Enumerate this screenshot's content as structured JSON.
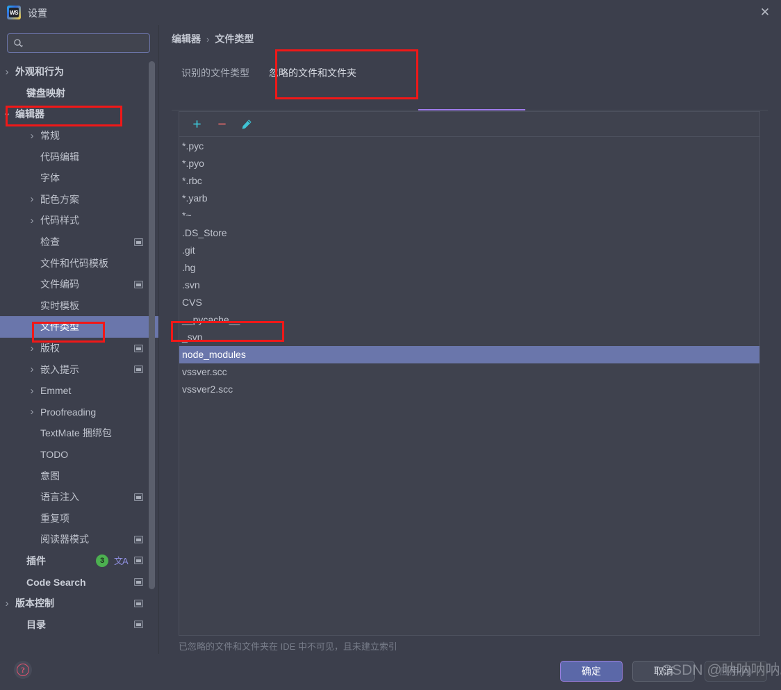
{
  "window": {
    "title": "设置",
    "app_icon": "webstorm-icon",
    "close_label": "✕"
  },
  "search": {
    "value": "",
    "placeholder": "",
    "icon": "search-icon"
  },
  "sidebar": {
    "items": [
      {
        "label": "外观和行为",
        "indent": 22,
        "chevron": "right",
        "bold": true,
        "sync": false,
        "selected": false
      },
      {
        "label": "键盘映射",
        "indent": 38,
        "chevron": "",
        "bold": true,
        "sync": false,
        "selected": false
      },
      {
        "label": "编辑器",
        "indent": 22,
        "chevron": "down",
        "bold": true,
        "sync": false,
        "selected": false
      },
      {
        "label": "常规",
        "indent": 58,
        "chevron": "right",
        "bold": false,
        "sync": false,
        "selected": false
      },
      {
        "label": "代码编辑",
        "indent": 58,
        "chevron": "",
        "bold": false,
        "sync": false,
        "selected": false
      },
      {
        "label": "字体",
        "indent": 58,
        "chevron": "",
        "bold": false,
        "sync": false,
        "selected": false
      },
      {
        "label": "配色方案",
        "indent": 58,
        "chevron": "right",
        "bold": false,
        "sync": false,
        "selected": false
      },
      {
        "label": "代码样式",
        "indent": 58,
        "chevron": "right",
        "bold": false,
        "sync": false,
        "selected": false
      },
      {
        "label": "检查",
        "indent": 58,
        "chevron": "",
        "bold": false,
        "sync": true,
        "selected": false
      },
      {
        "label": "文件和代码模板",
        "indent": 58,
        "chevron": "",
        "bold": false,
        "sync": false,
        "selected": false
      },
      {
        "label": "文件编码",
        "indent": 58,
        "chevron": "",
        "bold": false,
        "sync": true,
        "selected": false
      },
      {
        "label": "实时模板",
        "indent": 58,
        "chevron": "",
        "bold": false,
        "sync": false,
        "selected": false
      },
      {
        "label": "文件类型",
        "indent": 58,
        "chevron": "",
        "bold": false,
        "sync": false,
        "selected": true
      },
      {
        "label": "版权",
        "indent": 58,
        "chevron": "right",
        "bold": false,
        "sync": true,
        "selected": false
      },
      {
        "label": "嵌入提示",
        "indent": 58,
        "chevron": "right",
        "bold": false,
        "sync": true,
        "selected": false
      },
      {
        "label": "Emmet",
        "indent": 58,
        "chevron": "right",
        "bold": false,
        "sync": false,
        "selected": false
      },
      {
        "label": "Proofreading",
        "indent": 58,
        "chevron": "right",
        "bold": false,
        "sync": false,
        "selected": false
      },
      {
        "label": "TextMate 捆绑包",
        "indent": 58,
        "chevron": "",
        "bold": false,
        "sync": false,
        "selected": false
      },
      {
        "label": "TODO",
        "indent": 58,
        "chevron": "",
        "bold": false,
        "sync": false,
        "selected": false
      },
      {
        "label": "意图",
        "indent": 58,
        "chevron": "",
        "bold": false,
        "sync": false,
        "selected": false
      },
      {
        "label": "语言注入",
        "indent": 58,
        "chevron": "",
        "bold": false,
        "sync": true,
        "selected": false
      },
      {
        "label": "重复项",
        "indent": 58,
        "chevron": "",
        "bold": false,
        "sync": false,
        "selected": false
      },
      {
        "label": "阅读器模式",
        "indent": 58,
        "chevron": "",
        "bold": false,
        "sync": true,
        "selected": false
      },
      {
        "label": "插件",
        "indent": 38,
        "chevron": "",
        "bold": true,
        "sync": true,
        "selected": false,
        "badge": "3",
        "translate_icon": "translate-icon"
      },
      {
        "label": "Code Search",
        "indent": 38,
        "chevron": "",
        "bold": true,
        "sync": true,
        "selected": false
      },
      {
        "label": "版本控制",
        "indent": 22,
        "chevron": "right",
        "bold": true,
        "sync": true,
        "selected": false
      },
      {
        "label": "目录",
        "indent": 38,
        "chevron": "",
        "bold": true,
        "sync": true,
        "selected": false
      }
    ]
  },
  "main": {
    "breadcrumb": {
      "parent": "编辑器",
      "separator": "›",
      "current": "文件类型"
    },
    "tabs": [
      {
        "label": "识别的文件类型",
        "active": false
      },
      {
        "label": "忽略的文件和文件夹",
        "active": true
      }
    ],
    "toolbar": {
      "add_label": "+",
      "remove_label": "−",
      "edit_label": "edit-pencil-icon"
    },
    "ignored_items": [
      {
        "text": "*.pyc",
        "selected": false
      },
      {
        "text": "*.pyo",
        "selected": false
      },
      {
        "text": "*.rbc",
        "selected": false
      },
      {
        "text": "*.yarb",
        "selected": false
      },
      {
        "text": "*~",
        "selected": false
      },
      {
        "text": ".DS_Store",
        "selected": false
      },
      {
        "text": ".git",
        "selected": false
      },
      {
        "text": ".hg",
        "selected": false
      },
      {
        "text": ".svn",
        "selected": false
      },
      {
        "text": "CVS",
        "selected": false
      },
      {
        "text": "__pycache__",
        "selected": false
      },
      {
        "text": "_svn",
        "selected": false
      },
      {
        "text": "node_modules",
        "selected": true
      },
      {
        "text": "vssver.scc",
        "selected": false
      },
      {
        "text": "vssver2.scc",
        "selected": false
      }
    ],
    "hint": "已忽略的文件和文件夹在 IDE 中不可见，且未建立索引"
  },
  "footer": {
    "help_label": "?",
    "ok_label": "确定",
    "cancel_label": "取消",
    "apply_label": "应用(A)"
  },
  "watermark": {
    "text": "CSDN @呐呐呐呐。"
  },
  "colors": {
    "background": "#3c3f4c",
    "selection": "#6a76ab",
    "accent_tab": "#a07ded",
    "annotation": "#f01818",
    "badge_green": "#4cb050",
    "toolbar_add": "#3fc3d4",
    "toolbar_remove": "#e06a6a",
    "help_red": "#e0536f"
  }
}
